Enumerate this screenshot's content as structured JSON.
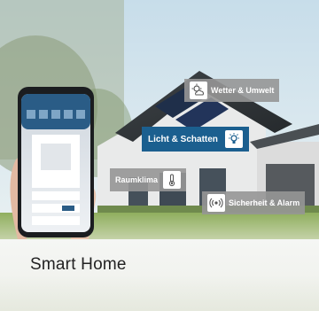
{
  "labels": {
    "weather": "Wetter & Umwelt",
    "light": "Licht & Schatten",
    "climate": "Raumklima",
    "security": "Sicherheit & Alarm"
  },
  "icons": {
    "weather": "sun-cloud-icon",
    "light": "lightbulb-icon",
    "climate": "thermometer-icon",
    "security": "sensor-icon"
  },
  "title": "Smart Home",
  "colors": {
    "accent_blue": "#1b5f8f",
    "pill_grey": "#969696"
  }
}
